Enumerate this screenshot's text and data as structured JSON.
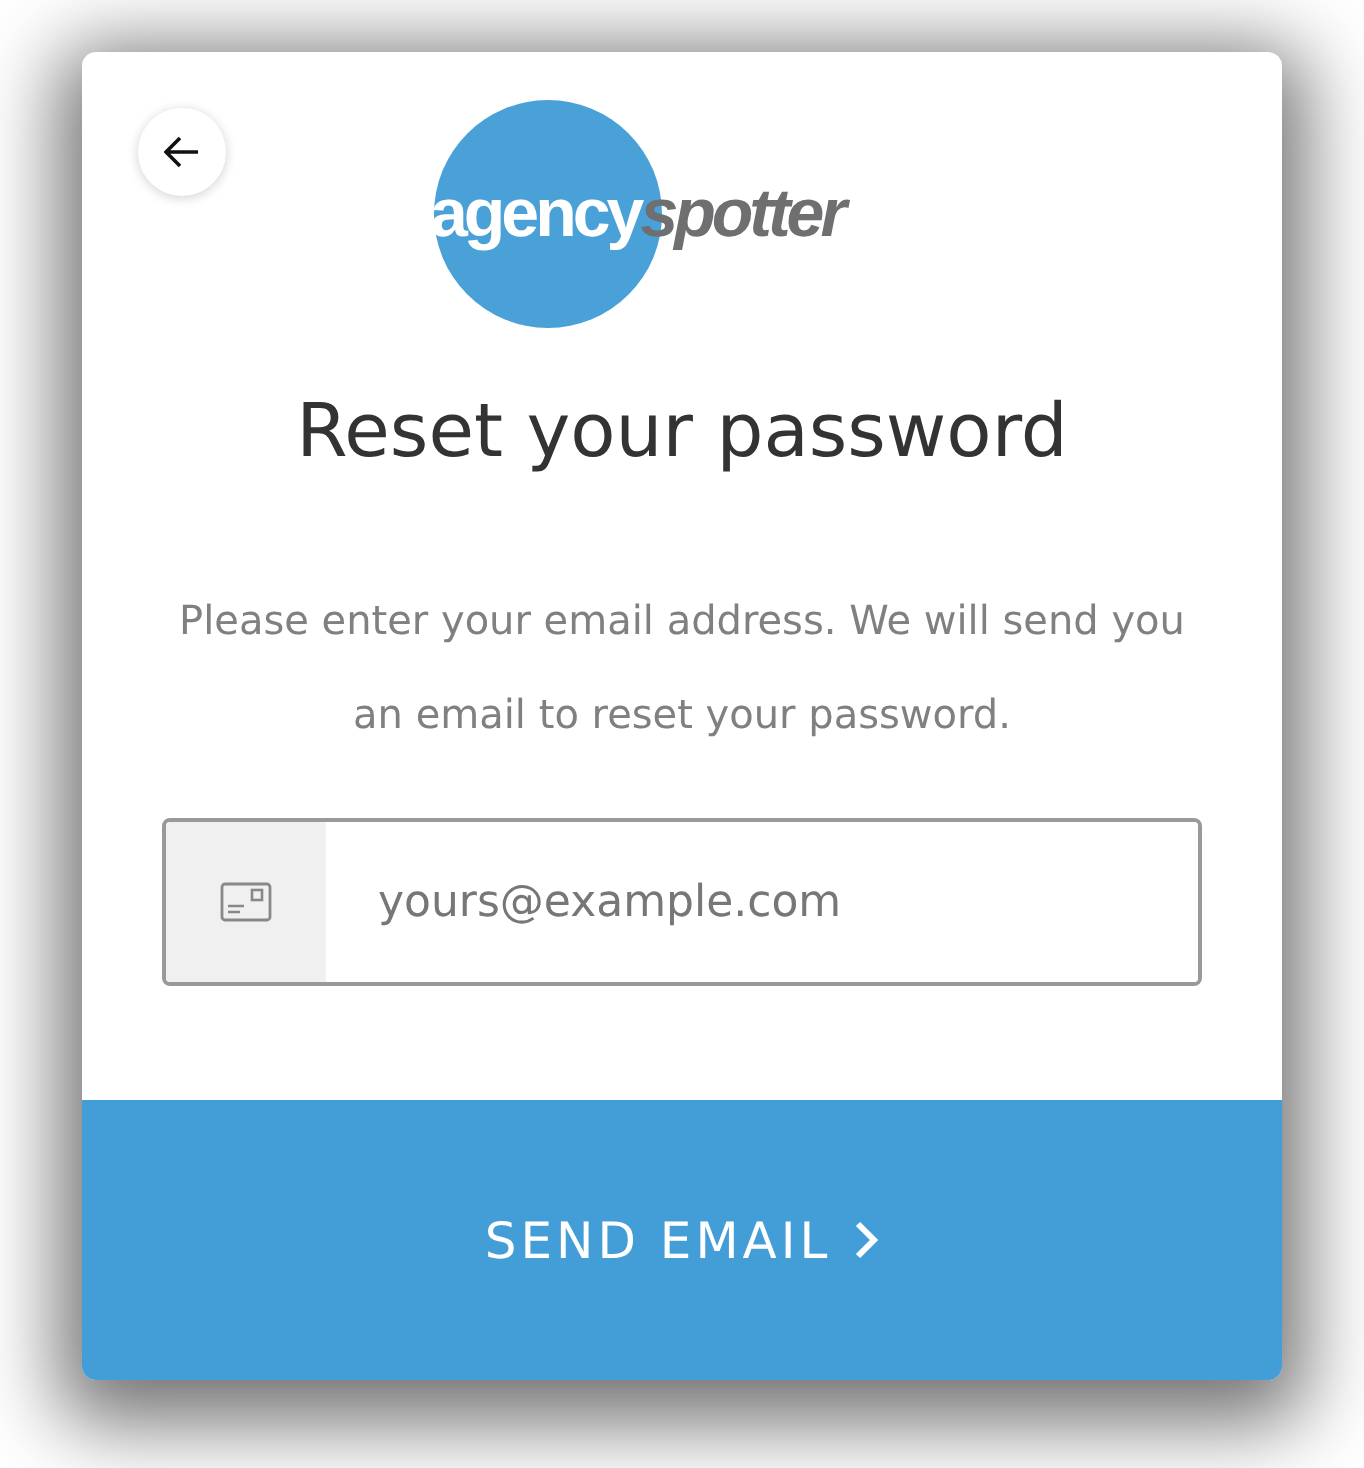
{
  "logo": {
    "part_1": "agency",
    "part_2": "spotter"
  },
  "title": "Reset your password",
  "description": "Please enter your email address. We will send you an email to reset your password.",
  "email_field": {
    "placeholder": "yours@example.com"
  },
  "submit_button": {
    "label": "SEND EMAIL"
  }
}
